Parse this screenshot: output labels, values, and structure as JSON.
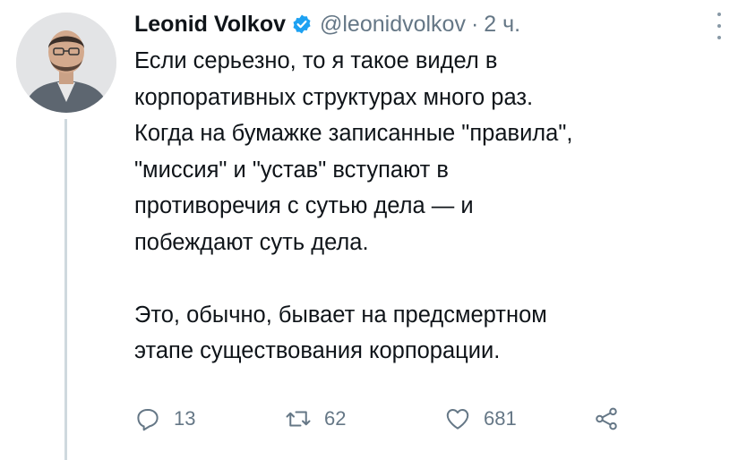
{
  "tweet": {
    "author_name": "Leonid Volkov",
    "handle": "@leonidvolkov",
    "separator": "·",
    "time": "2 ч.",
    "text": "Если серьезно, то я такое видел в\nкорпоративных структурах много раз.\nКогда на бумажке записанные \"правила\",\n\"миссия\" и \"устав\" вступают в\nпротиворечия с сутью дела — и\nпобеждают суть дела.\n\nЭто, обычно, бывает на предсмертном\nэтапе существования корпорации.",
    "replies": "13",
    "retweets": "62",
    "likes": "681"
  },
  "icons": {
    "verified": "verified-badge-icon",
    "more": "more-options-icon",
    "reply": "reply-icon",
    "retweet": "retweet-icon",
    "like": "heart-icon",
    "share": "share-icon"
  },
  "colors": {
    "text": "#0f1419",
    "secondary": "#657786",
    "verified": "#1da1f2",
    "thread_line": "#cfd9de"
  }
}
